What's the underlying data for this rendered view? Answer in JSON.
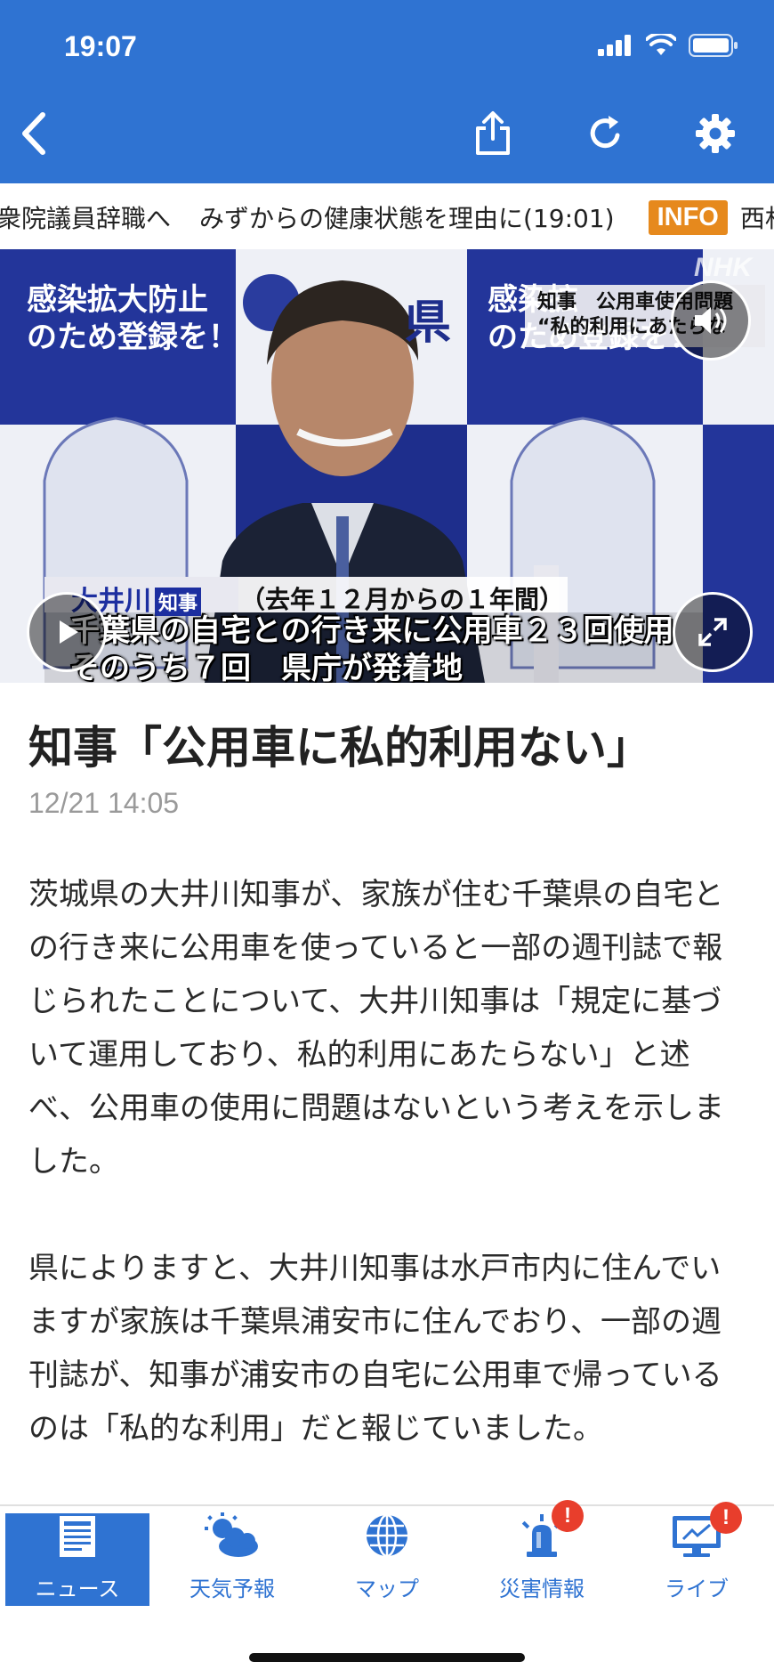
{
  "status_bar": {
    "time": "19:07"
  },
  "ticker": {
    "headline1": "衆院議員辞職へ",
    "headline2": "みずからの健康状態を理由に(19:01)",
    "badge": "INFO",
    "headline3": "西村"
  },
  "video": {
    "banner_left": "感染拡大防止",
    "banner_left_2": "のため登録を！",
    "banner_right": "感染拡",
    "banner_right_2": "のため登録を！",
    "logo_text": "県",
    "watermark": "NHK",
    "caption_top_1": "知事　公用車使用問題",
    "caption_top_2": "“私的利用にあたらな",
    "caption_name": "大井川",
    "caption_role": "知事",
    "caption_period": "（去年１２月からの１年間）",
    "caption_line1": "千葉県の自宅との行き来に公用車２３回使用",
    "caption_line2": "そのうち７回　県庁が発着地"
  },
  "article": {
    "title": "知事「公用車に私的利用ない」",
    "date": "12/21 14:05",
    "para1": "茨城県の大井川知事が、家族が住む千葉県の自宅との行き来に公用車を使っていると一部の週刊誌で報じられたことについて、大井川知事は「規定に基づいて運用しており、私的利用にあたらない」と述べ、公用車の使用に問題はないという考えを示しました。",
    "para2": "県によりますと、大井川知事は水戸市内に住んでいますが家族は千葉県浦安市に住んでおり、一部の週刊誌が、知事が浦安市の自宅に公用車で帰っているのは「私的な利用」だと報じていました。"
  },
  "tabbar": {
    "news": "ニュース",
    "weather": "天気予報",
    "map": "マップ",
    "disaster": "災害情報",
    "live": "ライブ",
    "disaster_badge": "!",
    "live_badge": "!"
  },
  "colors": {
    "brand": "#2f73d2",
    "info_badge": "#e6891d",
    "alert": "#e83e2c"
  }
}
